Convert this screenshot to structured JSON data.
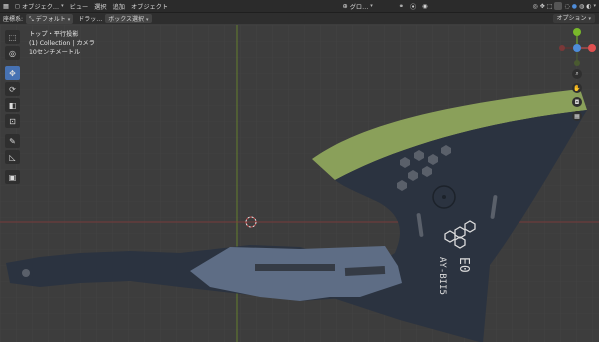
{
  "header": {
    "editor_icon": "grid-editor-icon",
    "mode_label": "オブジェク…",
    "menu": [
      "ビュー",
      "選択",
      "追加",
      "オブジェクト"
    ],
    "transform_label": "グロ…",
    "right_mode": "S",
    "colors": {
      "accent": "#4772b3",
      "x_axis": "#e05050",
      "y_axis": "#79b82a",
      "z_axis": "#4e8cd9"
    }
  },
  "toolrow": {
    "orientation_label": "座標系:",
    "orientation_value": "デフォルト",
    "drag_label": "ドラッ…",
    "select_label": "ボックス選択",
    "option_label": "オプション"
  },
  "overlay": {
    "view_name": "トップ・平行投影",
    "collection": "(1) Collection | カメラ",
    "scale": "10センチメートル"
  },
  "object": {
    "text_right": "E0",
    "text_model": "AY-BII5"
  }
}
